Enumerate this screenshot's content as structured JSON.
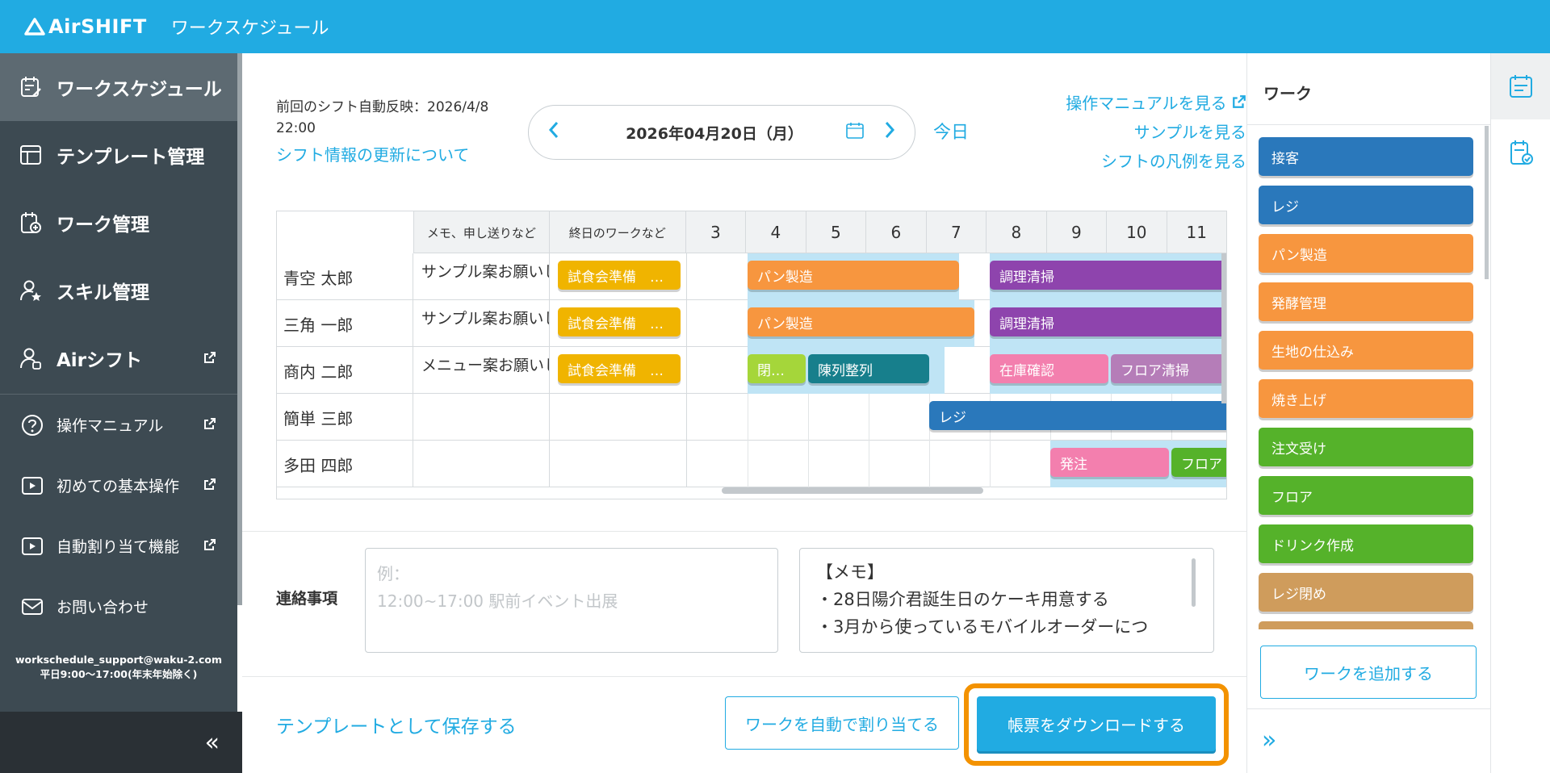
{
  "header": {
    "logo": "AirSHIFT",
    "title": "ワークスケジュール"
  },
  "sidebar": {
    "main_items": [
      {
        "label": "ワークスケジュール",
        "icon": "schedule-edit-icon",
        "active": true
      },
      {
        "label": "テンプレート管理",
        "icon": "template-icon"
      },
      {
        "label": "ワーク管理",
        "icon": "work-add-icon"
      },
      {
        "label": "スキル管理",
        "icon": "skill-person-icon"
      },
      {
        "label": "Airシフト",
        "icon": "person-icon",
        "external": true
      }
    ],
    "sub_items": [
      {
        "label": "操作マニュアル",
        "icon": "question-icon"
      },
      {
        "label": "初めての基本操作",
        "icon": "play-icon"
      },
      {
        "label": "自動割り当て機能",
        "icon": "play-icon"
      },
      {
        "label": "お問い合わせ",
        "icon": "mail-icon"
      }
    ],
    "support_email": "workschedule_support@waku-2.com",
    "support_hours": "平日9:00〜17:00(年末年始除く)",
    "collapse": "«"
  },
  "toolbar": {
    "last_sync": "前回のシフト自動反映：2026/4/8 22:00",
    "update_link": "シフト情報の更新について",
    "date": "2026年04月20日（月）",
    "today": "今日",
    "links": [
      "操作マニュアルを見る",
      "サンプルを見る",
      "シフトの凡例を見る"
    ]
  },
  "grid": {
    "col_memo": "メモ、申し送りなど",
    "col_allday": "終日のワークなど",
    "hours": [
      "3",
      "4",
      "5",
      "6",
      "7",
      "8",
      "9",
      "10",
      "11"
    ],
    "rows": [
      {
        "name": "青空 太郎",
        "memo": "サンプル案お願いします",
        "allday": "試食会準備　…",
        "tasks": [
          {
            "label": "パン製造",
            "color": "#f7963f"
          },
          {
            "label": "調理清掃",
            "color": "#8e44ad"
          }
        ]
      },
      {
        "name": "三角 一郎",
        "memo": "サンプル案お願いします",
        "allday": "試食会準備　…",
        "tasks": [
          {
            "label": "パン製造",
            "color": "#f7963f"
          },
          {
            "label": "調理清掃",
            "color": "#8e44ad"
          }
        ]
      },
      {
        "name": "商内 二郎",
        "memo": "メニュー案お願いします",
        "allday": "試食会準備　…",
        "tasks": [
          {
            "label": "閉…",
            "color": "#a5d63a"
          },
          {
            "label": "陳列整列",
            "color": "#177f8c"
          },
          {
            "label": "在庫確認",
            "color": "#f37fae"
          },
          {
            "label": "フロア清掃",
            "color": "#b57db8"
          }
        ]
      },
      {
        "name": "簡単 三郎",
        "memo": "",
        "allday": "",
        "tasks": [
          {
            "label": "レジ",
            "color": "#2a78bb"
          }
        ]
      },
      {
        "name": "多田 四郎",
        "memo": "",
        "allday": "",
        "tasks": [
          {
            "label": "発注",
            "color": "#f37fae"
          },
          {
            "label": "フロア",
            "color": "#55b22a"
          }
        ]
      }
    ]
  },
  "contact": {
    "label": "連絡事項",
    "placeholder": "例：\n12:00~17:00 駅前イベント出展",
    "placeholder_line1": "例：",
    "placeholder_line2": "12:00~17:00 駅前イベント出展",
    "memo_lines": [
      "【メモ】",
      "・28日陽介君誕生日のケーキ用意する",
      "・3月から使っているモバイルオーダーにつ"
    ]
  },
  "footer": {
    "save_template": "テンプレートとして保存する",
    "auto_assign": "ワークを自動で割り当てる",
    "download": "帳票をダウンロードする"
  },
  "work_panel": {
    "title": "ワーク",
    "items": [
      {
        "label": "接客",
        "color": "#2a78bb"
      },
      {
        "label": "レジ",
        "color": "#2a78bb"
      },
      {
        "label": "パン製造",
        "color": "#f7963f"
      },
      {
        "label": "発酵管理",
        "color": "#f7963f"
      },
      {
        "label": "生地の仕込み",
        "color": "#f7963f"
      },
      {
        "label": "焼き上げ",
        "color": "#f7963f"
      },
      {
        "label": "注文受け",
        "color": "#55b22a"
      },
      {
        "label": "フロア",
        "color": "#55b22a"
      },
      {
        "label": "ドリンク作成",
        "color": "#55b22a"
      },
      {
        "label": "レジ閉め",
        "color": "#cf9c5c"
      },
      {
        "label": "",
        "color": "#cf9c5c"
      }
    ],
    "add_button": "ワークを追加する",
    "expand": "»"
  }
}
